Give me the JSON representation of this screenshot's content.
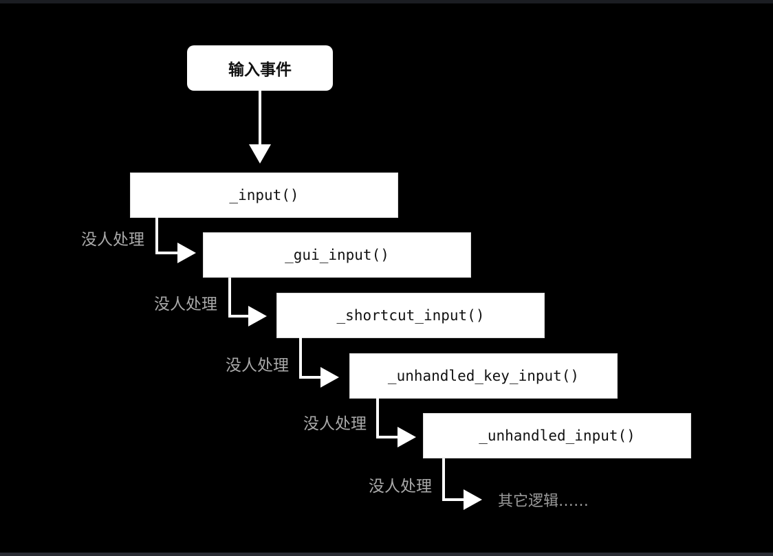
{
  "diagram": {
    "start": "输入事件",
    "steps": [
      "_input()",
      "_gui_input()",
      "_shortcut_input()",
      "_unhandled_key_input()",
      "_unhandled_input()"
    ],
    "fallthrough_label": "没人处理",
    "end": "其它逻辑……"
  },
  "colors": {
    "background": "#000000",
    "node_fill": "#ffffff",
    "node_text": "#111111",
    "label_text": "#a9a9a9",
    "arrow": "#ffffff"
  }
}
